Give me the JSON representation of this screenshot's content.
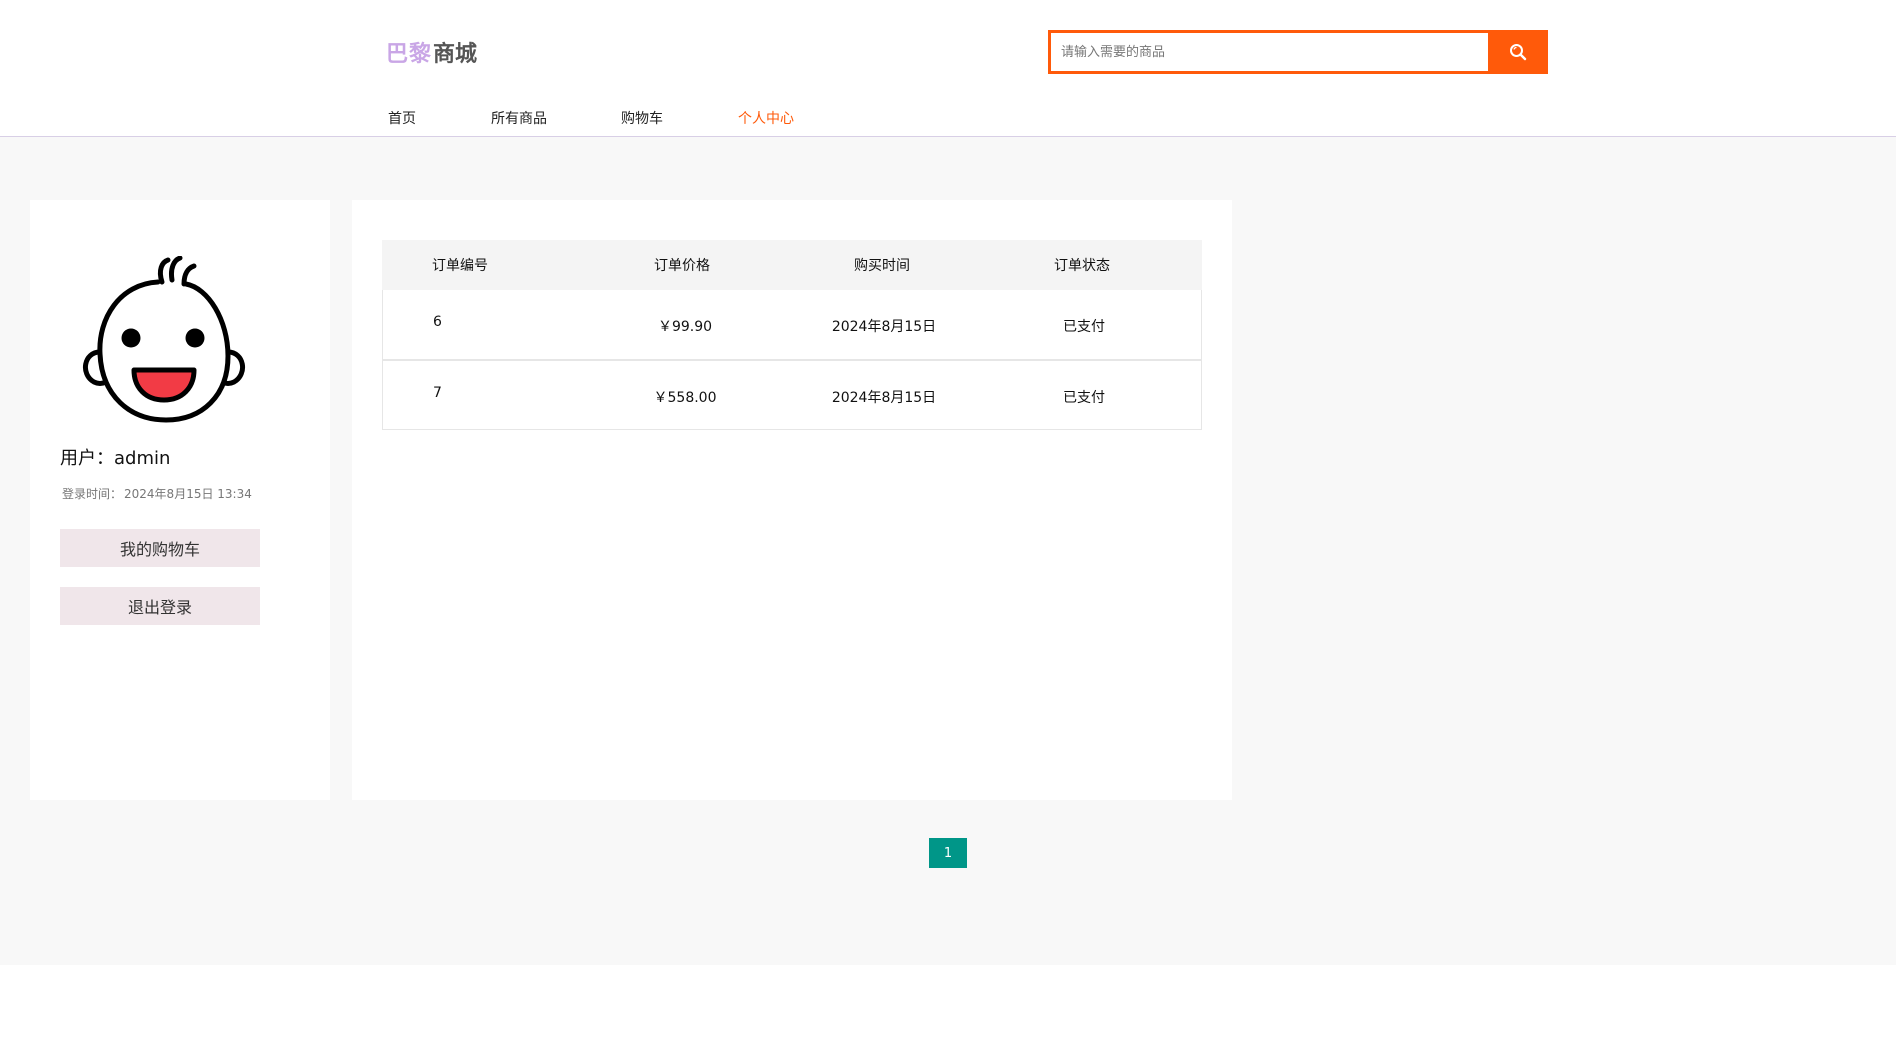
{
  "header": {
    "logo_mark": "巴黎",
    "logo_text": "商城",
    "search": {
      "placeholder": "请输入需要的商品",
      "value": ""
    },
    "nav": [
      {
        "label": "首页"
      },
      {
        "label": "所有商品"
      },
      {
        "label": "购物车"
      },
      {
        "label": "个人中心",
        "active": true
      }
    ]
  },
  "profile": {
    "user_label": "用户：",
    "username": "admin",
    "login_time_label": "登录时间：",
    "login_time": "2024年8月15日 13:34",
    "cart_button": "我的购物车",
    "logout_button": "退出登录"
  },
  "orders": {
    "columns": [
      "订单编号",
      "订单价格",
      "购买时间",
      "订单状态"
    ],
    "rows": [
      {
        "id": "6",
        "price": "￥99.90",
        "time": "2024年8月15日",
        "status": "已支付"
      },
      {
        "id": "7",
        "price": "￥558.00",
        "time": "2024年8月15日",
        "status": "已支付"
      }
    ]
  },
  "pagination": {
    "current_page": "1"
  },
  "colors": {
    "accent": "#ff5a0a",
    "page_button": "#009688",
    "side_button_bg": "#f0e6ea",
    "logo_mark": "#c9a6e6"
  }
}
